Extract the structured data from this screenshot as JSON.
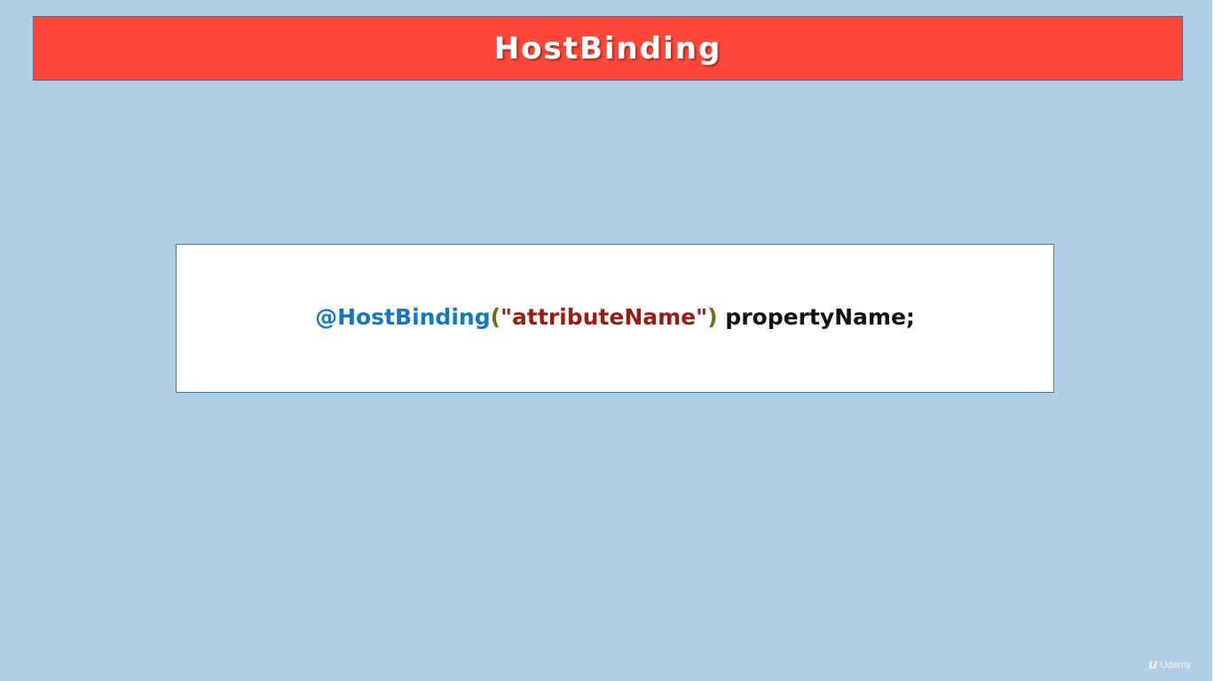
{
  "slide": {
    "title": "HostBinding",
    "code": {
      "decorator": "@HostBinding",
      "open_paren": "(",
      "string": "\"attributeName\"",
      "close_paren": ")",
      "property": " propertyName;"
    },
    "watermark": {
      "logo_glyph": "u",
      "text": "Udemy"
    },
    "colors": {
      "background": "#b0cfe4",
      "title_bar": "#fd4739",
      "decorator": "#0f79c1",
      "string": "#9a1d12",
      "paren": "#7a6b12"
    }
  }
}
